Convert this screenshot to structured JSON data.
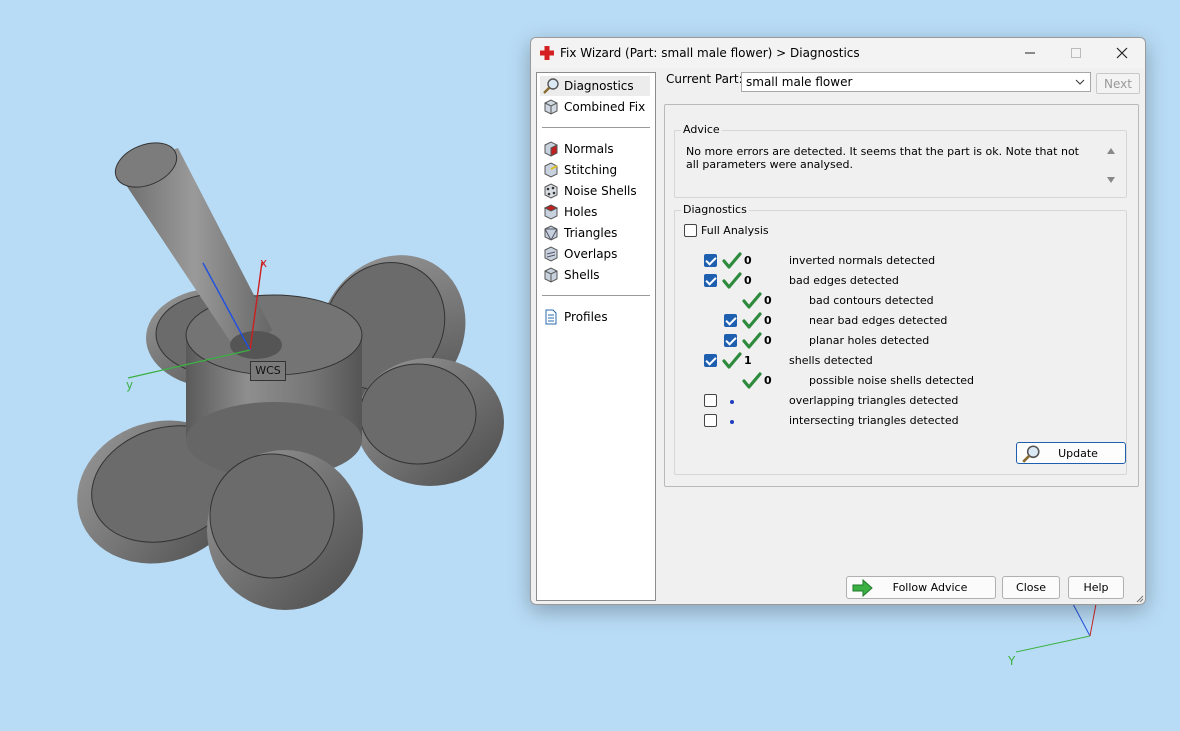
{
  "viewport": {
    "wcs_label": "WCS",
    "axis_x_label": "x",
    "axis_y_label": "y",
    "mini_axis_y_label": "Y"
  },
  "dialog": {
    "title": "Fix Wizard (Part: small male flower) > Diagnostics",
    "app_icon": "red-cross-icon",
    "window_controls": [
      "minimize-icon",
      "maximize-icon",
      "close-icon"
    ]
  },
  "nav": {
    "items": [
      {
        "label": "Diagnostics",
        "icon": "magnifier-icon",
        "selected": true
      },
      {
        "label": "Combined Fix",
        "icon": "combined-fix-cube-icon"
      },
      {
        "label": "Normals",
        "icon": "normals-cube-icon"
      },
      {
        "label": "Stitching",
        "icon": "stitching-cube-icon"
      },
      {
        "label": "Noise Shells",
        "icon": "noise-shells-icon"
      },
      {
        "label": "Holes",
        "icon": "holes-cube-icon"
      },
      {
        "label": "Triangles",
        "icon": "triangles-cube-icon"
      },
      {
        "label": "Overlaps",
        "icon": "overlaps-cube-icon"
      },
      {
        "label": "Shells",
        "icon": "shells-cube-icon"
      },
      {
        "label": "Profiles",
        "icon": "document-icon"
      }
    ]
  },
  "header": {
    "current_part_label": "Current Part:",
    "current_part_value": "small male flower",
    "next_label": "Next"
  },
  "advice": {
    "title": "Advice",
    "text": "No more errors are detected. It seems that the part is ok. Note that not all parameters were analysed."
  },
  "diagnostics": {
    "title": "Diagnostics",
    "full_analysis_label": "Full Analysis",
    "full_analysis_checked": false,
    "rows": [
      {
        "label": "inverted normals detected",
        "count": "0",
        "checkbox": true,
        "checked": true,
        "status": "check",
        "indent": 0
      },
      {
        "label": "bad edges detected",
        "count": "0",
        "checkbox": true,
        "checked": true,
        "status": "check",
        "indent": 0
      },
      {
        "label": "bad contours detected",
        "count": "0",
        "checkbox": false,
        "checked": false,
        "status": "check",
        "indent": 1
      },
      {
        "label": "near bad edges detected",
        "count": "0",
        "checkbox": true,
        "checked": true,
        "status": "check",
        "indent": 1
      },
      {
        "label": "planar holes detected",
        "count": "0",
        "checkbox": true,
        "checked": true,
        "status": "check",
        "indent": 1
      },
      {
        "label": "shells detected",
        "count": "1",
        "checkbox": true,
        "checked": true,
        "status": "check",
        "indent": 0
      },
      {
        "label": "possible noise shells detected",
        "count": "0",
        "checkbox": false,
        "checked": false,
        "status": "check",
        "indent": 1
      },
      {
        "label": "overlapping triangles detected",
        "count": "",
        "checkbox": true,
        "checked": false,
        "status": "dot",
        "indent": 0
      },
      {
        "label": "intersecting triangles detected",
        "count": "",
        "checkbox": true,
        "checked": false,
        "status": "dot",
        "indent": 0
      }
    ],
    "update_label": "Update"
  },
  "footer": {
    "follow_advice_label": "Follow Advice",
    "close_label": "Close",
    "help_label": "Help"
  },
  "colors": {
    "background": "#b9dcf6",
    "check_green": "#2e8b3e",
    "checkbox_blue": "#1f5fb0",
    "axis_red": "#cc2020",
    "axis_green": "#3cb043",
    "axis_blue": "#2050e0"
  }
}
